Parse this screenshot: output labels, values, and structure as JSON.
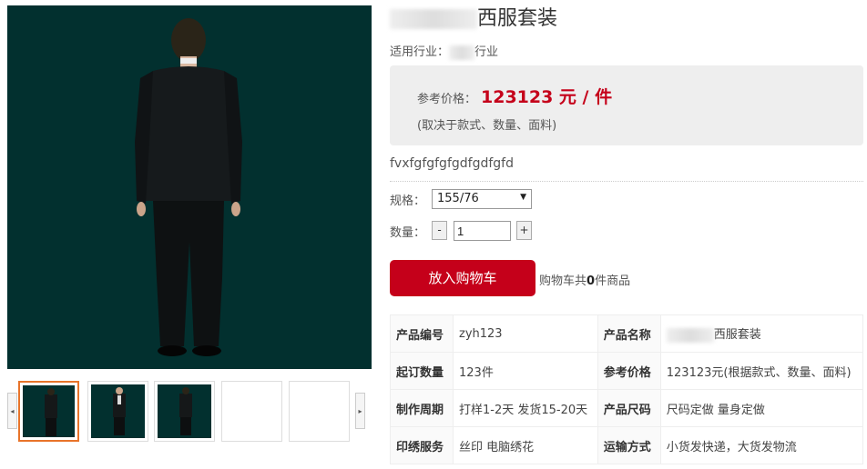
{
  "product": {
    "title_suffix": "西服套装",
    "industry_label": "适用行业：",
    "industry_suffix": "行业",
    "price_label": "参考价格：",
    "price_value": "123123 元 / 件",
    "price_note": "(取决于款式、数量、面料)",
    "description": "fvxfgfgfgfgdfgdfgfd"
  },
  "options": {
    "spec_label": "规格：",
    "spec_value": "155/76",
    "qty_label": "数量：",
    "qty_minus": "-",
    "qty_value": "1",
    "qty_plus": "+"
  },
  "cart": {
    "button_label": "放入购物车",
    "info_prefix": "购物车共",
    "count": "0",
    "info_suffix": "件商品"
  },
  "gallery": {
    "prev_arrow": "◂",
    "next_arrow": "▸",
    "thumbnails": [
      "back-view",
      "front-view",
      "back-view",
      "empty",
      "empty"
    ]
  },
  "specs_table": [
    {
      "k1": "产品编号",
      "v1": "zyh123",
      "k2": "产品名称",
      "v2": "西服套装"
    },
    {
      "k1": "起订数量",
      "v1": "123件",
      "k2": "参考价格",
      "v2": "123123元(根据款式、数量、面料)"
    },
    {
      "k1": "制作周期",
      "v1": "打样1-2天 发货15-20天",
      "k2": "产品尺码",
      "v2": "尺码定做 量身定做"
    },
    {
      "k1": "印绣服务",
      "v1": "丝印 电脑绣花",
      "k2": "运输方式",
      "v2": "小货发快递，大货发物流"
    }
  ],
  "colors": {
    "accent": "#c5001a",
    "image_bg": "#02302f",
    "thumb_active": "#e8742a"
  }
}
